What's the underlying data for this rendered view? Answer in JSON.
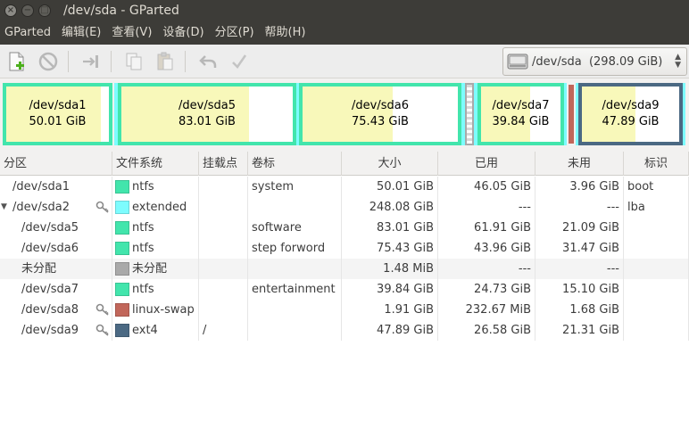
{
  "window": {
    "title": "/dev/sda - GParted"
  },
  "menu": [
    "GParted",
    "编辑(E)",
    "查看(V)",
    "设备(D)",
    "分区(P)",
    "帮助(H)"
  ],
  "device": {
    "label": "/dev/sda",
    "size": "(298.09 GiB)"
  },
  "colors": {
    "ntfs": "#42e5ac",
    "extended": "#7dfcfe",
    "unallocated": "#a9a9a9",
    "linux_swap": "#c1665a",
    "ext4": "#4b6983",
    "used": "#f8f8ba",
    "free": "#ffffff"
  },
  "graph": [
    {
      "name": "/dev/sda1",
      "size": "50.01 GiB",
      "used_fraction": 0.921,
      "fs": "ntfs"
    },
    {
      "name": "/dev/sda5",
      "size": "83.01 GiB",
      "used_fraction": 0.746,
      "fs": "ntfs"
    },
    {
      "name": "/dev/sda6",
      "size": "75.43 GiB",
      "used_fraction": 0.583,
      "fs": "ntfs"
    },
    {
      "name": "/dev/sda7",
      "size": "39.84 GiB",
      "used_fraction": 0.621,
      "fs": "ntfs"
    },
    {
      "name": "/dev/sda9",
      "size": "47.89 GiB",
      "used_fraction": 0.555,
      "fs": "ext4"
    }
  ],
  "table": {
    "headers": [
      "分区",
      "文件系统",
      "挂载点",
      "卷标",
      "大小",
      "已用",
      "未用",
      "标识"
    ],
    "rows": [
      {
        "partition": "/dev/sda1",
        "fs": "ntfs",
        "mount": "",
        "label": "system",
        "size": "50.01 GiB",
        "used": "46.05 GiB",
        "unused": "3.96 GiB",
        "flags": "boot",
        "key": false,
        "indent": false,
        "expander": false,
        "color": "ntfs"
      },
      {
        "partition": "/dev/sda2",
        "fs": "extended",
        "mount": "",
        "label": "",
        "size": "248.08 GiB",
        "used": "---",
        "unused": "---",
        "flags": "lba",
        "key": true,
        "indent": false,
        "expander": true,
        "color": "extended"
      },
      {
        "partition": "/dev/sda5",
        "fs": "ntfs",
        "mount": "",
        "label": "software",
        "size": "83.01 GiB",
        "used": "61.91 GiB",
        "unused": "21.09 GiB",
        "flags": "",
        "key": false,
        "indent": true,
        "expander": false,
        "color": "ntfs"
      },
      {
        "partition": "/dev/sda6",
        "fs": "ntfs",
        "mount": "",
        "label": "step forword",
        "size": "75.43 GiB",
        "used": "43.96 GiB",
        "unused": "31.47 GiB",
        "flags": "",
        "key": false,
        "indent": true,
        "expander": false,
        "color": "ntfs"
      },
      {
        "partition": "未分配",
        "fs": "未分配",
        "mount": "",
        "label": "",
        "size": "1.48 MiB",
        "used": "---",
        "unused": "---",
        "flags": "",
        "key": false,
        "indent": true,
        "expander": false,
        "color": "unallocated"
      },
      {
        "partition": "/dev/sda7",
        "fs": "ntfs",
        "mount": "",
        "label": "entertainment",
        "size": "39.84 GiB",
        "used": "24.73 GiB",
        "unused": "15.10 GiB",
        "flags": "",
        "key": false,
        "indent": true,
        "expander": false,
        "color": "ntfs"
      },
      {
        "partition": "/dev/sda8",
        "fs": "linux-swap",
        "mount": "",
        "label": "",
        "size": "1.91 GiB",
        "used": "232.67 MiB",
        "unused": "1.68 GiB",
        "flags": "",
        "key": true,
        "indent": true,
        "expander": false,
        "color": "linux_swap"
      },
      {
        "partition": "/dev/sda9",
        "fs": "ext4",
        "mount": "/",
        "label": "",
        "size": "47.89 GiB",
        "used": "26.58 GiB",
        "unused": "21.31 GiB",
        "flags": "",
        "key": true,
        "indent": true,
        "expander": false,
        "color": "ext4"
      }
    ]
  }
}
